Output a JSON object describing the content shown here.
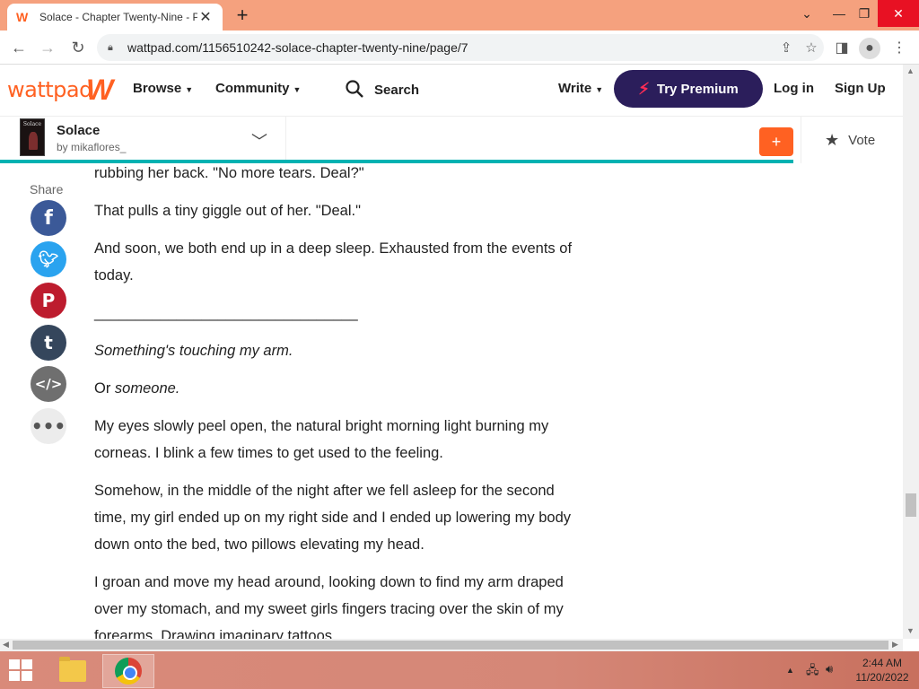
{
  "browser": {
    "tab_title": "Solace - Chapter Twenty-Nine - P",
    "tab_close": "✕",
    "new_tab": "+",
    "url": "wattpad.com/1156510242-solace-chapter-twenty-nine/page/7",
    "window_controls": {
      "minimize": "⌄",
      "restore": "—",
      "maximize": "❐",
      "close": "✕"
    }
  },
  "header": {
    "logo": "wattpad",
    "nav": {
      "browse": "Browse",
      "community": "Community",
      "search": "Search",
      "write": "Write"
    },
    "premium": "Try Premium",
    "login": "Log in",
    "signup": "Sign Up"
  },
  "story": {
    "cover_text": "Solace",
    "title": "Solace",
    "author": "by mikaflores_",
    "add": "+",
    "vote": "Vote"
  },
  "share": {
    "label": "Share"
  },
  "content": {
    "p1": "rubbing her back. \"No more tears. Deal?\"",
    "p2": "That pulls a tiny giggle out of her. \"Deal.\"",
    "p3": "And soon, we both end up in a deep sleep. Exhausted from the events of today.",
    "divider": "________________________________",
    "p4": "Something's touching my arm.",
    "p5_a": "Or ",
    "p5_b": "someone.",
    "p6": "My eyes slowly peel open, the natural bright morning light burning my corneas. I blink a few times to get used to the feeling.",
    "p7": "Somehow, in the middle of the night after we fell asleep for the second time, my girl ended up on my right side and I ended up lowering my body down onto the bed, two pillows elevating my head.",
    "p8": "I groan and move my head around, looking down to find my arm draped over my stomach, and my sweet girls fingers tracing over the skin of my forearms. Drawing imaginary tattoos."
  },
  "taskbar": {
    "time": "2:44 AM",
    "date": "11/20/2022"
  },
  "colors": {
    "brand": "#ff6122",
    "premium_bg": "#2b1e5b",
    "progress": "#00b2b2",
    "tabstrip": "#f5a17e"
  },
  "icons": [
    "wattpad-favicon",
    "back-icon",
    "forward-icon",
    "reload-icon",
    "lock-icon",
    "share-page-icon",
    "bookmark-star-icon",
    "sidepanel-icon",
    "profile-icon",
    "menu-dots-icon",
    "search-icon",
    "bolt-icon",
    "chevron-down-icon",
    "star-icon",
    "facebook-icon",
    "twitter-icon",
    "pinterest-icon",
    "tumblr-icon",
    "embed-icon",
    "more-icon",
    "windows-start-icon",
    "file-explorer-icon",
    "chrome-icon"
  ]
}
